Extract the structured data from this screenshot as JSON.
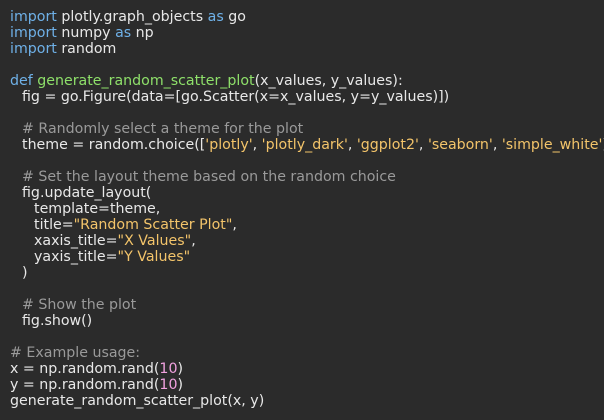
{
  "editor": {
    "colors": {
      "background": "#2b2b2b",
      "text": "#e8e8e8",
      "keyword": "#6fb1e8",
      "function_name": "#8ee06a",
      "string": "#f3c46a",
      "number": "#f2a2e0",
      "comment": "#9a9a9a"
    },
    "lines": [
      {
        "tokens": [
          {
            "t": "import",
            "c": "kw"
          },
          {
            "t": " plotly.graph_objects ",
            "c": "pl"
          },
          {
            "t": "as",
            "c": "kw"
          },
          {
            "t": " go",
            "c": "pl"
          }
        ]
      },
      {
        "tokens": [
          {
            "t": "import",
            "c": "kw"
          },
          {
            "t": " numpy ",
            "c": "pl"
          },
          {
            "t": "as",
            "c": "kw"
          },
          {
            "t": " np",
            "c": "pl"
          }
        ]
      },
      {
        "tokens": [
          {
            "t": "import",
            "c": "kw"
          },
          {
            "t": " random",
            "c": "pl"
          }
        ]
      },
      {
        "tokens": []
      },
      {
        "tokens": [
          {
            "t": "def",
            "c": "kw"
          },
          {
            "t": " ",
            "c": "pl"
          },
          {
            "t": "generate_random_scatter_plot",
            "c": "fn"
          },
          {
            "t": "(x_values, y_values):",
            "c": "pl"
          }
        ]
      },
      {
        "indent": 1,
        "tokens": [
          {
            "t": "fig ",
            "c": "pl"
          },
          {
            "t": "=",
            "c": "op"
          },
          {
            "t": " go.Figure(data",
            "c": "pl"
          },
          {
            "t": "=",
            "c": "op"
          },
          {
            "t": "[go.Scatter(x",
            "c": "pl"
          },
          {
            "t": "=",
            "c": "op"
          },
          {
            "t": "x_values, y",
            "c": "pl"
          },
          {
            "t": "=",
            "c": "op"
          },
          {
            "t": "y_values)])",
            "c": "pl"
          }
        ]
      },
      {
        "tokens": []
      },
      {
        "indent": 1,
        "tokens": [
          {
            "t": "# Randomly select a theme for the plot",
            "c": "cm"
          }
        ]
      },
      {
        "indent": 1,
        "tokens": [
          {
            "t": "theme ",
            "c": "pl"
          },
          {
            "t": "=",
            "c": "op"
          },
          {
            "t": " random.choice([",
            "c": "pl"
          },
          {
            "t": "'plotly'",
            "c": "str"
          },
          {
            "t": ", ",
            "c": "pl"
          },
          {
            "t": "'plotly_dark'",
            "c": "str"
          },
          {
            "t": ", ",
            "c": "pl"
          },
          {
            "t": "'ggplot2'",
            "c": "str"
          },
          {
            "t": ", ",
            "c": "pl"
          },
          {
            "t": "'seaborn'",
            "c": "str"
          },
          {
            "t": ", ",
            "c": "pl"
          },
          {
            "t": "'simple_white'",
            "c": "str"
          },
          {
            "t": "])",
            "c": "pl"
          }
        ]
      },
      {
        "tokens": []
      },
      {
        "indent": 1,
        "tokens": [
          {
            "t": "# Set the layout theme based on the random choice",
            "c": "cm"
          }
        ]
      },
      {
        "indent": 1,
        "tokens": [
          {
            "t": "fig.update_layout(",
            "c": "pl"
          }
        ]
      },
      {
        "indent": 2,
        "tokens": [
          {
            "t": "template",
            "c": "pl"
          },
          {
            "t": "=",
            "c": "op"
          },
          {
            "t": "theme,",
            "c": "pl"
          }
        ]
      },
      {
        "indent": 2,
        "tokens": [
          {
            "t": "title",
            "c": "pl"
          },
          {
            "t": "=",
            "c": "op"
          },
          {
            "t": "\"Random Scatter Plot\"",
            "c": "str"
          },
          {
            "t": ",",
            "c": "pl"
          }
        ]
      },
      {
        "indent": 2,
        "tokens": [
          {
            "t": "xaxis_title",
            "c": "pl"
          },
          {
            "t": "=",
            "c": "op"
          },
          {
            "t": "\"X Values\"",
            "c": "str"
          },
          {
            "t": ",",
            "c": "pl"
          }
        ]
      },
      {
        "indent": 2,
        "tokens": [
          {
            "t": "yaxis_title",
            "c": "pl"
          },
          {
            "t": "=",
            "c": "op"
          },
          {
            "t": "\"Y Values\"",
            "c": "str"
          }
        ]
      },
      {
        "indent": 1,
        "tokens": [
          {
            "t": ")",
            "c": "pl"
          }
        ]
      },
      {
        "tokens": []
      },
      {
        "indent": 1,
        "tokens": [
          {
            "t": "# Show the plot",
            "c": "cm"
          }
        ]
      },
      {
        "indent": 1,
        "tokens": [
          {
            "t": "fig.show()",
            "c": "pl"
          }
        ]
      },
      {
        "tokens": []
      },
      {
        "tokens": [
          {
            "t": "# Example usage:",
            "c": "cm"
          }
        ]
      },
      {
        "tokens": [
          {
            "t": "x ",
            "c": "pl"
          },
          {
            "t": "=",
            "c": "op"
          },
          {
            "t": " np.random.rand(",
            "c": "pl"
          },
          {
            "t": "10",
            "c": "num"
          },
          {
            "t": ")",
            "c": "pl"
          }
        ]
      },
      {
        "tokens": [
          {
            "t": "y ",
            "c": "pl"
          },
          {
            "t": "=",
            "c": "op"
          },
          {
            "t": " np.random.rand(",
            "c": "pl"
          },
          {
            "t": "10",
            "c": "num"
          },
          {
            "t": ")",
            "c": "pl"
          }
        ]
      },
      {
        "tokens": [
          {
            "t": "generate_random_scatter_plot(x, y)",
            "c": "pl"
          }
        ]
      }
    ]
  }
}
